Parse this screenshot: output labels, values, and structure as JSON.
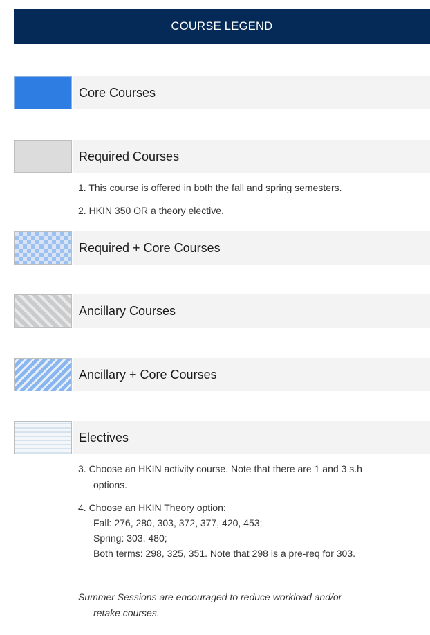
{
  "header": {
    "title": "COURSE LEGEND"
  },
  "legend": [
    {
      "label": "Core Courses",
      "color": "#2d7de3"
    },
    {
      "label": "Required Courses",
      "color": "#dcdcdc"
    },
    {
      "label": "Required + Core Courses",
      "color": "#9cc1f0"
    },
    {
      "label": "Ancillary Courses",
      "color": "#c9cbcc"
    },
    {
      "label": "Ancillary + Core Courses",
      "color": "#8ab6f0"
    },
    {
      "label": "Electives",
      "color": "#d6e3ee"
    }
  ],
  "notes": {
    "n1": "1. This course is offered in both the fall and spring semesters.",
    "n2": "2. HKIN 350 OR a theory elective.",
    "n3_line1": "3. Choose an HKIN activity course. Note that there are 1 and 3 s.h",
    "n3_line2": "options.",
    "n4_line1": "4. Choose an HKIN Theory option:",
    "n4_fall": "Fall: 276, 280, 303, 372, 377, 420, 453;",
    "n4_spring": "Spring: 303, 480;",
    "n4_both": "Both terms: 298, 325, 351. Note that 298 is a pre-req for 303.",
    "summer_line1": "Summer Sessions are encouraged to reduce workload and/or",
    "summer_line2": "retake courses."
  }
}
